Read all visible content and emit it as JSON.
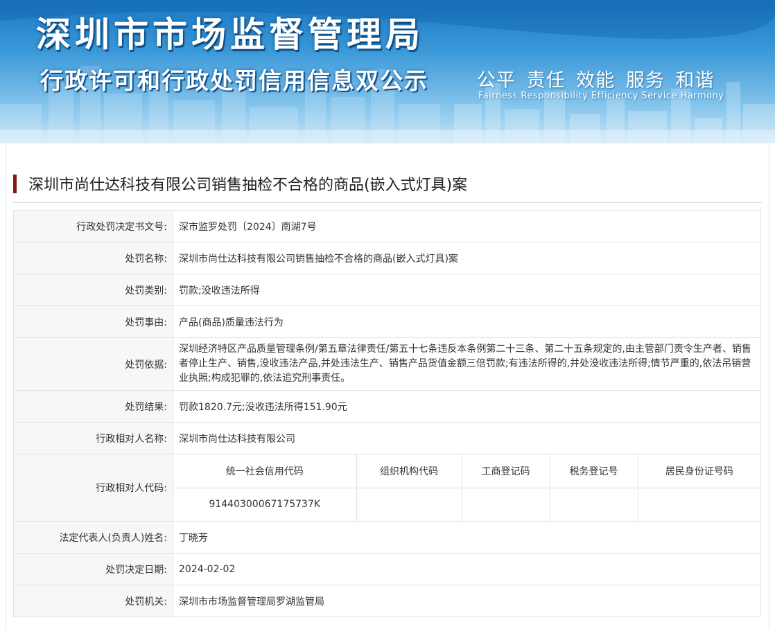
{
  "banner": {
    "title": "深圳市市场监督管理局",
    "subtitle": "行政许可和行政处罚信用信息双公示",
    "slogan": "公平 责任 效能 服务 和谐",
    "slogan_en": "Fairness Responsibility Efficiency Service Harmony"
  },
  "case": {
    "title": "深圳市尚仕达科技有限公司销售抽检不合格的商品(嵌入式灯具)案"
  },
  "fields": {
    "doc_no": {
      "label": "行政处罚决定书文号:",
      "value": "深市监罗处罚〔2024〕南湖7号"
    },
    "penalty_name": {
      "label": "处罚名称:",
      "value": "深圳市尚仕达科技有限公司销售抽检不合格的商品(嵌入式灯具)案"
    },
    "penalty_type": {
      "label": "处罚类别:",
      "value": "罚款;没收违法所得"
    },
    "penalty_reason": {
      "label": "处罚事由:",
      "value": "产品(商品)质量违法行为"
    },
    "penalty_basis": {
      "label": "处罚依据:",
      "value": "深圳经济特区产品质量管理条例/第五章法律责任/第五十七条违反本条例第二十三条、第二十五条规定的,由主管部门责令生产者、销售者停止生产、销售,没收违法产品,并处违法生产、销售产品货值金额三倍罚款;有违法所得的,并处没收违法所得;情节严重的,依法吊销营业执照;构成犯罪的,依法追究刑事责任。"
    },
    "penalty_result": {
      "label": "处罚结果:",
      "value": "罚款1820.7元;没收违法所得151.90元"
    },
    "party_name": {
      "label": "行政相对人名称:",
      "value": "深圳市尚仕达科技有限公司"
    },
    "party_code": {
      "label": "行政相对人代码:",
      "headers": [
        "统一社会信用代码",
        "组织机构代码",
        "工商登记码",
        "税务登记号",
        "居民身份证号码"
      ],
      "values": [
        "91440300067175737K",
        "",
        "",
        "",
        ""
      ]
    },
    "legal_rep": {
      "label": "法定代表人(负责人)姓名:",
      "value": "丁晓芳"
    },
    "decision_date": {
      "label": "处罚决定日期:",
      "value": "2024-02-02"
    },
    "authority": {
      "label": "处罚机关:",
      "value": "深圳市市场监督管理局罗湖监管局"
    }
  }
}
